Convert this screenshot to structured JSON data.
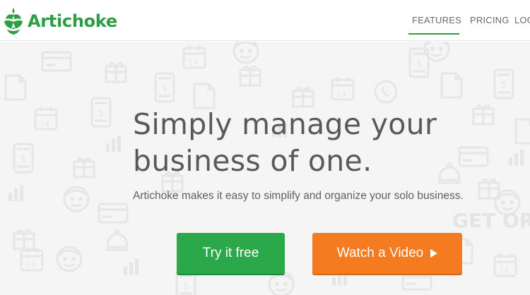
{
  "header": {
    "brand_name": "Artichoke",
    "logo_icon": "artichoke-icon",
    "nav": [
      {
        "label": "FEATURES",
        "active": true
      },
      {
        "label": "PRICING",
        "active": false
      },
      {
        "label": "LOG",
        "active": false
      }
    ]
  },
  "hero": {
    "headline_line1": "Simply manage your",
    "headline_line2": "business of one.",
    "subline": "Artichoke makes it easy to simplify and organize your solo business.",
    "background_watermark": "GET ORGA",
    "buttons": {
      "try_label": "Try it free",
      "video_label": "Watch a Video",
      "video_icon": "play-icon"
    }
  },
  "colors": {
    "brand_green": "#2e9e44",
    "try_button": "#2aa84a",
    "video_button": "#f47b20",
    "headline_text": "#595959",
    "hero_bg": "#f5f5f5"
  }
}
